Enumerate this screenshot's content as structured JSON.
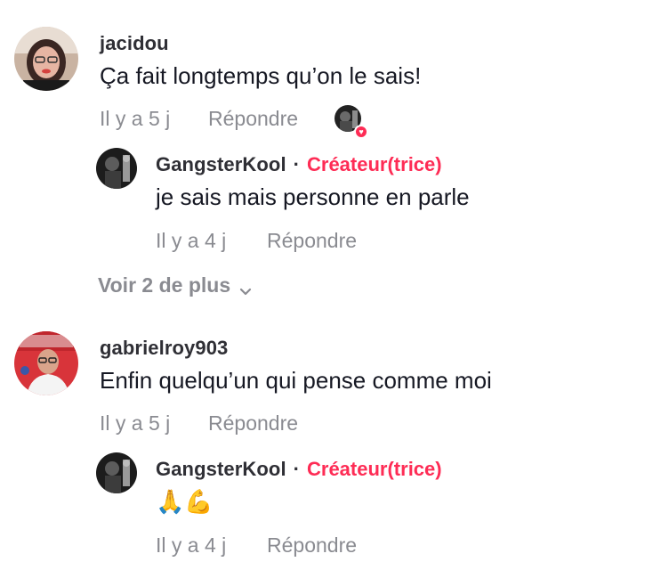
{
  "comments": [
    {
      "username": "jacidou",
      "text": "Ça fait longtemps qu’on le sais!",
      "time": "Il y a 5 j",
      "reply_label": "Répondre",
      "replies": [
        {
          "username": "GangsterKool",
          "separator": "·",
          "badge": "Créateur(trice)",
          "text": "je sais mais personne en parle",
          "time": "Il y a 4 j",
          "reply_label": "Répondre"
        }
      ],
      "more_replies_label": "Voir 2 de plus"
    },
    {
      "username": "gabrielroy903",
      "text": "Enfin quelqu’un qui pense comme moi",
      "time": "Il y a 5 j",
      "reply_label": "Répondre",
      "replies": [
        {
          "username": "GangsterKool",
          "separator": "·",
          "badge": "Créateur(trice)",
          "text": "🙏💪",
          "time": "Il y a 4 j",
          "reply_label": "Répondre"
        }
      ]
    }
  ],
  "colors": {
    "creator_badge": "#fe2c55",
    "meta_text": "#8a8b91",
    "primary_text": "#161823"
  },
  "icons": {
    "creator_liked": "heart-icon",
    "expand": "chevron-down-icon"
  }
}
